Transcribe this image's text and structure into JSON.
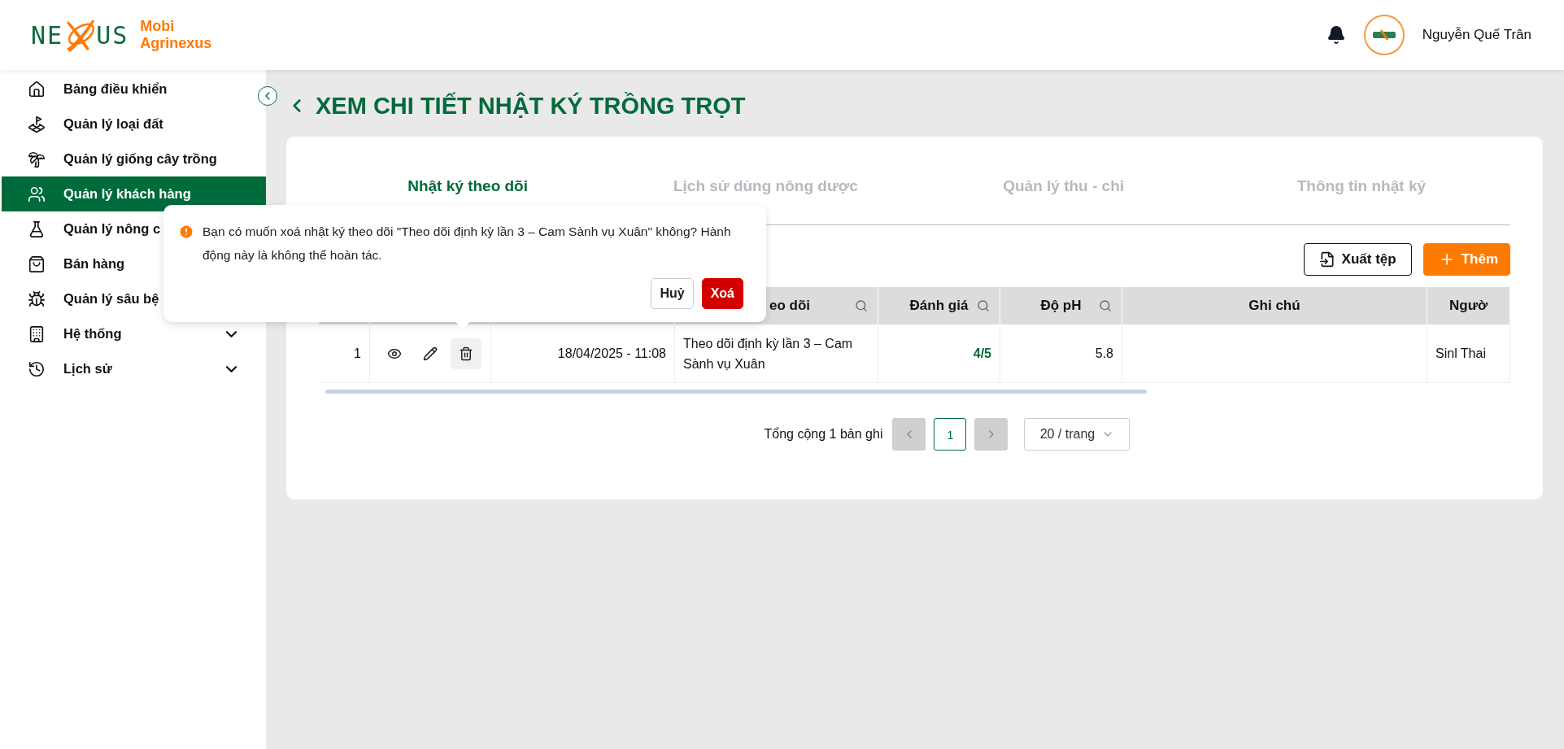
{
  "brand": {
    "logo_left": "NE",
    "logo_right": "US",
    "name_line1": "Mobi",
    "name_line2": "Agrinexus"
  },
  "header": {
    "user_name": "Nguyễn Quế Trân"
  },
  "sidebar": {
    "items": [
      {
        "label": "Bảng điều khiển",
        "kind": "link",
        "selected": false
      },
      {
        "label": "Quản lý loại đất",
        "kind": "link",
        "selected": false
      },
      {
        "label": "Quản lý giống cây trồng",
        "kind": "link",
        "selected": false
      },
      {
        "label": "Quản lý khách hàng",
        "kind": "link",
        "selected": true
      },
      {
        "label": "Quản lý nông c",
        "kind": "link",
        "selected": false
      },
      {
        "label": "Bán hàng",
        "kind": "link",
        "selected": false
      },
      {
        "label": "Quản lý sâu bệ",
        "kind": "link",
        "selected": false
      },
      {
        "label": "Hệ thống",
        "kind": "group",
        "selected": false,
        "expanded": false
      },
      {
        "label": "Lịch sử",
        "kind": "group",
        "selected": false,
        "expanded": false
      }
    ]
  },
  "page": {
    "title": "XEM CHI TIẾT NHẬT KÝ TRỒNG TRỌT"
  },
  "tabs": [
    {
      "label": "Nhật ký theo dõi",
      "selected": true
    },
    {
      "label": "Lịch sử dùng nông dược",
      "selected": false
    },
    {
      "label": "Quản lý thu - chi",
      "selected": false
    },
    {
      "label": "Thông tin nhật ký",
      "selected": false
    }
  ],
  "toolbar": {
    "export_label": "Xuất tệp",
    "add_label": "Thêm"
  },
  "table": {
    "columns": [
      {
        "label": "eo dõi",
        "searchable": true
      },
      {
        "label": "Đánh giá",
        "searchable": true
      },
      {
        "label": "Độ pH",
        "searchable": true
      },
      {
        "label": "Ghi chú",
        "searchable": false
      },
      {
        "label": "Ngườ",
        "searchable": false
      }
    ],
    "rows": [
      {
        "index": "1",
        "actions": [
          {
            "kind": "view",
            "selected": false
          },
          {
            "kind": "edit",
            "selected": false
          },
          {
            "kind": "delete",
            "selected": true
          }
        ],
        "date": "18/04/2025 - 11:08",
        "name": "Theo dõi định kỳ lần 3 – Cam Sành vụ Xuân",
        "rating": "4/5",
        "ph": "5.8",
        "person": "Sinl Thai"
      }
    ]
  },
  "pagination": {
    "total": "Tổng cộng 1 bản ghi",
    "prev_disabled": true,
    "next_disabled": true,
    "pages": [
      {
        "label": "1",
        "selected": true
      }
    ],
    "page_size": "20 / trang"
  },
  "popconfirm": {
    "message": "Bạn có muốn xoá nhật ký theo dõi \"Theo dõi định kỳ lần 3 – Cam Sành vụ Xuân\" không? Hành động này là không thể hoàn tác.",
    "cancel": "Huỷ",
    "confirm": "Xoá"
  }
}
